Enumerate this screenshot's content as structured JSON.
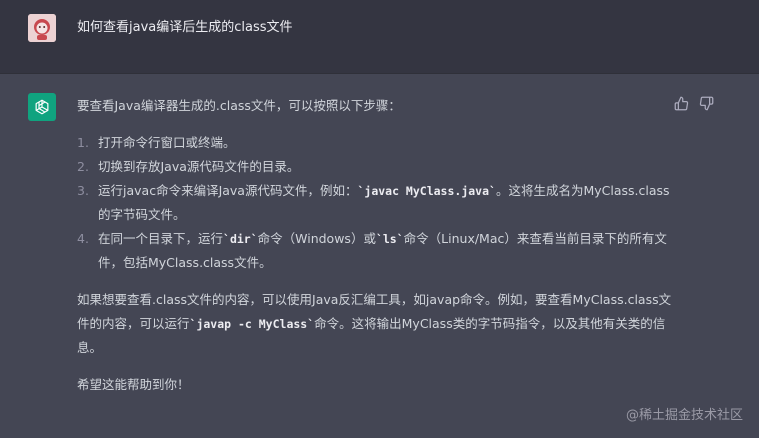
{
  "conversation": {
    "user_question": "如何查看java编译后生成的class文件"
  },
  "answer": {
    "intro": "要查看Java编译器生成的.class文件，可以按照以下步骤：",
    "steps": [
      {
        "num": "1.",
        "parts": [
          {
            "t": "打开命令行窗口或终端。"
          }
        ]
      },
      {
        "num": "2.",
        "parts": [
          {
            "t": "切换到存放Java源代码文件的目录。"
          }
        ]
      },
      {
        "num": "3.",
        "parts": [
          {
            "t": "运行javac命令来编译Java源代码文件，例如："
          },
          {
            "c": "`javac MyClass.java`"
          },
          {
            "t": "。这将生成名为MyClass.class的字节码文件。"
          }
        ]
      },
      {
        "num": "4.",
        "parts": [
          {
            "t": "在同一个目录下，运行"
          },
          {
            "c": "`dir`"
          },
          {
            "t": "命令（Windows）或"
          },
          {
            "c": "`ls`"
          },
          {
            "t": "命令（Linux/Mac）来查看当前目录下的所有文件，包括MyClass.class文件。"
          }
        ]
      }
    ],
    "paragraph2": [
      {
        "t": "如果想要查看.class文件的内容，可以使用Java反汇编工具，如javap命令。例如，要查看MyClass.class文件的内容，可以运行"
      },
      {
        "c": "`javap -c MyClass`"
      },
      {
        "t": "命令。这将输出MyClass类的字节码指令，以及其他有关类的信息。"
      }
    ],
    "closing": "希望这能帮助到你！"
  },
  "icons": {
    "user_avatar": "user-avatar-icon",
    "assistant_avatar": "openai-logo-icon",
    "thumbs_up": "thumbs-up-icon",
    "thumbs_down": "thumbs-down-icon"
  },
  "watermark": "@稀土掘金技术社区",
  "colors": {
    "user_row_bg": "#343541",
    "assistant_row_bg": "#444654",
    "assistant_avatar_bg": "#10a37f"
  }
}
